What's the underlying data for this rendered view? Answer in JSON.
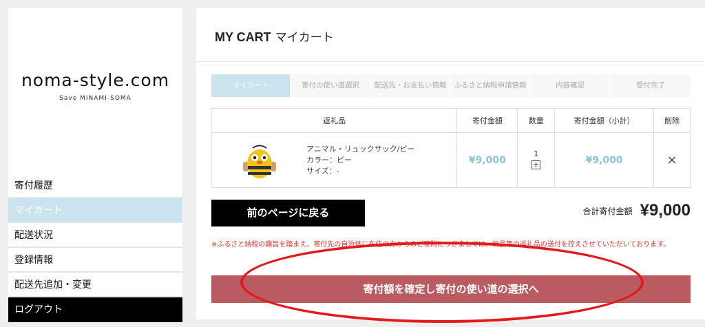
{
  "site": {
    "title": "noma-style.com",
    "subtitle": "Save MINAMI-SOMA"
  },
  "sidebar": {
    "items": [
      {
        "label": "寄付履歴"
      },
      {
        "label": "マイカート"
      },
      {
        "label": "配送状況"
      },
      {
        "label": "登録情報"
      },
      {
        "label": "配送先追加・変更"
      },
      {
        "label": "ログアウト"
      }
    ]
  },
  "header": {
    "title_en": "MY CART",
    "title_ja": "マイカート"
  },
  "steps": [
    {
      "label": "マイカート"
    },
    {
      "label": "寄付の使い道選択"
    },
    {
      "label": "配送先・お支払い情報"
    },
    {
      "label": "ふるさと納税申請情報"
    },
    {
      "label": "内容確認"
    },
    {
      "label": "受付完了"
    }
  ],
  "table": {
    "headers": [
      "返礼品",
      "寄付金額",
      "数量",
      "寄付金額（小計）",
      "削除"
    ],
    "rows": [
      {
        "name": "アニマル・リュックサック/ビー",
        "color": "カラー：ビー",
        "size": "サイズ：-",
        "price": "¥9,000",
        "quantity": "1",
        "subtotal": "¥9,000",
        "delete": "×"
      }
    ]
  },
  "back_button": "前のページに戻る",
  "total": {
    "label": "合計寄付金額",
    "value": "¥9,000"
  },
  "notice": "※ふるさと納税の趣旨を踏まえ、寄付先の自治体に在住の方からのご寄附につきましては、物品等の返礼品の送付を控えさせていただいております。",
  "confirm_button": "寄付額を確定し寄付の使い道の選択へ",
  "colors": {
    "accent_blue": "#c9e3ef",
    "price_blue": "#8ec3d9",
    "confirm_red": "#b95b60",
    "notice_red": "#e0322b"
  }
}
